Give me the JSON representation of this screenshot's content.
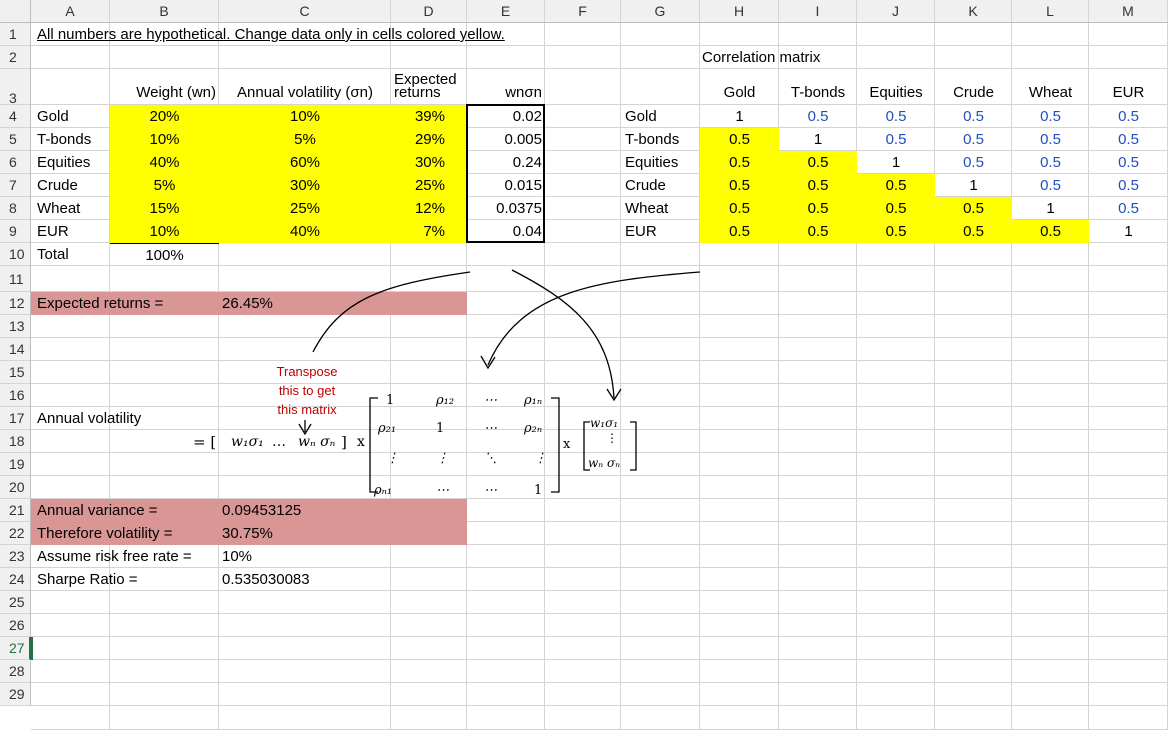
{
  "columns": [
    "A",
    "B",
    "C",
    "D",
    "E",
    "F",
    "G",
    "H",
    "I",
    "J",
    "K",
    "L",
    "M"
  ],
  "rows": [
    "1",
    "2",
    "3",
    "4",
    "5",
    "6",
    "7",
    "8",
    "9",
    "10",
    "11",
    "12",
    "13",
    "14",
    "15",
    "16",
    "17",
    "18",
    "19",
    "20",
    "21",
    "22",
    "23",
    "24",
    "25",
    "26",
    "27",
    "28",
    "29"
  ],
  "selected_row": "27",
  "note": "All numbers are hypothetical.  Change data only in cells colored yellow.",
  "headers": {
    "weight": "Weight (wn)",
    "volatility": "Annual volatility (σn)",
    "expected_1": "Expected",
    "expected_2": "returns",
    "wnsn": "wnσn"
  },
  "assets": [
    {
      "name": "Gold",
      "weight": "20%",
      "vol": "10%",
      "ret": "39%",
      "ws": "0.02"
    },
    {
      "name": "T-bonds",
      "weight": "10%",
      "vol": "5%",
      "ret": "29%",
      "ws": "0.005"
    },
    {
      "name": "Equities",
      "weight": "40%",
      "vol": "60%",
      "ret": "30%",
      "ws": "0.24"
    },
    {
      "name": "Crude",
      "weight": "5%",
      "vol": "30%",
      "ret": "25%",
      "ws": "0.015"
    },
    {
      "name": "Wheat",
      "weight": "15%",
      "vol": "25%",
      "ret": "12%",
      "ws": "0.0375"
    },
    {
      "name": "EUR",
      "weight": "10%",
      "vol": "40%",
      "ret": "7%",
      "ws": "0.04"
    }
  ],
  "total_label": "Total",
  "total_weight": "100%",
  "correlation_title": "Correlation matrix",
  "corr_headers": [
    "Gold",
    "T-bonds",
    "Equities",
    "Crude",
    "Wheat",
    "EUR"
  ],
  "corr_rows": [
    {
      "name": "Gold",
      "vals": [
        "1",
        "0.5",
        "0.5",
        "0.5",
        "0.5",
        "0.5"
      ]
    },
    {
      "name": "T-bonds",
      "vals": [
        "0.5",
        "1",
        "0.5",
        "0.5",
        "0.5",
        "0.5"
      ]
    },
    {
      "name": "Equities",
      "vals": [
        "0.5",
        "0.5",
        "1",
        "0.5",
        "0.5",
        "0.5"
      ]
    },
    {
      "name": "Crude",
      "vals": [
        "0.5",
        "0.5",
        "0.5",
        "1",
        "0.5",
        "0.5"
      ]
    },
    {
      "name": "Wheat",
      "vals": [
        "0.5",
        "0.5",
        "0.5",
        "0.5",
        "1",
        "0.5"
      ]
    },
    {
      "name": "EUR",
      "vals": [
        "0.5",
        "0.5",
        "0.5",
        "0.5",
        "0.5",
        "1"
      ]
    }
  ],
  "expected_returns_label": "Expected returns =",
  "expected_returns_value": "26.45%",
  "transpose_note": [
    "Transpose",
    "this to get",
    "this matrix"
  ],
  "annual_volatility_label": "Annual volatility",
  "formula": {
    "eq": "= [",
    "w1s1": "w₁σ₁",
    "dots": "…",
    "wnsn": "wₙ σₙ",
    "close": "]",
    "x1": "x",
    "x2": "x",
    "m11": "1",
    "m12": "ρ₁₂",
    "m13": "⋯",
    "m14": "ρ₁ₙ",
    "m21": "ρ₂₁",
    "m22": "1",
    "m23": "⋯",
    "m24": "ρ₂ₙ",
    "m31": "⋮",
    "m32": "⋮",
    "m33": "⋱",
    "m34": "⋮",
    "m41": "ρₙ₁",
    "m42": "⋯",
    "m43": "⋯",
    "m44": "1",
    "v1": "w₁σ₁",
    "v2": "⋮",
    "v3": "wₙ σₙ"
  },
  "annual_variance_label": "Annual variance =",
  "annual_variance_value": "0.09453125",
  "volatility_label": "Therefore volatility =",
  "volatility_value": "30.75%",
  "risk_free_label": "Assume risk free rate =",
  "risk_free_value": "10%",
  "sharpe_label": "Sharpe Ratio =",
  "sharpe_value": "0.535030083",
  "colors": {
    "yellow": "#ffff00",
    "pink": "#da9694",
    "blue": "#1f4fbf",
    "red": "#c00000"
  }
}
